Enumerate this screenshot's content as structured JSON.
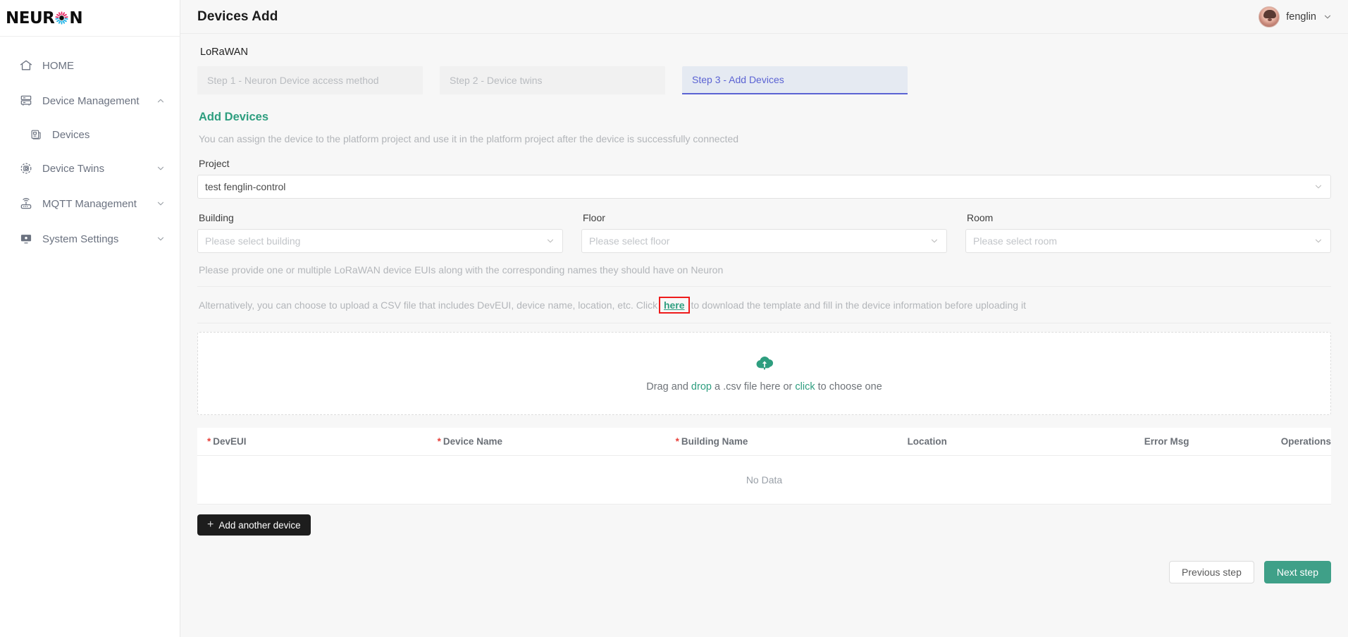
{
  "brand": {
    "name_part1": "NEUR",
    "name_part2": "N",
    "gear_icon": "gear-sun-icon"
  },
  "sidebar": {
    "items": [
      {
        "label": "HOME",
        "icon": "home-icon",
        "expandable": false,
        "sub": false
      },
      {
        "label": "Device Management",
        "icon": "server-icon",
        "expandable": true,
        "chevron": "chevron-up-icon",
        "sub": false
      },
      {
        "label": "Devices",
        "icon": "device-list-icon",
        "expandable": false,
        "sub": true
      },
      {
        "label": "Device Twins",
        "icon": "twin-circle-icon",
        "expandable": true,
        "chevron": "chevron-down-icon",
        "sub": false
      },
      {
        "label": "MQTT Management",
        "icon": "router-icon",
        "expandable": true,
        "chevron": "chevron-down-icon",
        "sub": false
      },
      {
        "label": "System Settings",
        "icon": "monitor-icon",
        "expandable": true,
        "chevron": "chevron-down-icon",
        "sub": false
      }
    ]
  },
  "header": {
    "title": "Devices Add",
    "user_name": "fenglin",
    "avatar_icon": "user-avatar",
    "caret_icon": "chevron-down-icon"
  },
  "wizard": {
    "protocol": "LoRaWAN",
    "steps": [
      {
        "label": "Step 1 - Neuron Device access method",
        "active": false
      },
      {
        "label": "Step 2 - Device twins",
        "active": false
      },
      {
        "label": "Step 3 - Add Devices",
        "active": true
      }
    ]
  },
  "form": {
    "section_title": "Add Devices",
    "section_desc": "You can assign the device to the platform project and use it in the platform project after the device is successfully connected",
    "project_label": "Project",
    "project_value": "test fenglin-control",
    "building_label": "Building",
    "building_placeholder": "Please select building",
    "floor_label": "Floor",
    "floor_placeholder": "Please select floor",
    "room_label": "Room",
    "room_placeholder": "Please select room"
  },
  "notes": {
    "note1": "Please provide one or multiple LoRaWAN device EUIs along with the corresponding names they should have on Neuron",
    "note2_prefix": "Alternatively, you can choose to upload a CSV file that includes DevEUI, device name, location, etc. Click",
    "note2_link": "here",
    "note2_suffix": "to download the template and fill in the device information before uploading it"
  },
  "dropzone": {
    "icon": "cloud-upload-icon",
    "text_prefix": "Drag and ",
    "text_link1": "drop",
    "text_middle": " a .csv file here or ",
    "text_link2": "click",
    "text_suffix": " to choose one"
  },
  "table": {
    "columns": [
      {
        "label": "DevEUI",
        "required": true
      },
      {
        "label": "Device Name",
        "required": true
      },
      {
        "label": "Building Name",
        "required": true
      },
      {
        "label": "Location",
        "required": false
      },
      {
        "label": "Error Msg",
        "required": false
      },
      {
        "label": "Operations",
        "required": false
      }
    ],
    "rows": [],
    "empty_text": "No Data"
  },
  "actions": {
    "add_another": "Add another device",
    "add_icon": "plus-icon",
    "previous": "Previous step",
    "next": "Next step"
  },
  "colors": {
    "accent_green": "#2e9e7f",
    "next_button": "#3fa088",
    "step_active_text": "#5b63d3",
    "highlight_box": "#ee1b1b",
    "required_star": "#e8403a"
  }
}
